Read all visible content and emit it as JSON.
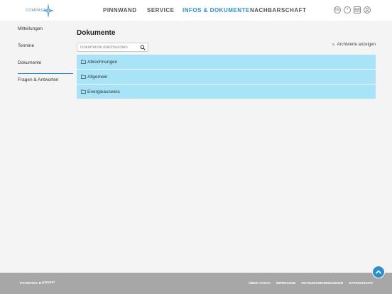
{
  "header": {
    "logo_text": "COMPASS",
    "nav": [
      {
        "label": "PINNWAND",
        "active": false
      },
      {
        "label": "SERVICE",
        "active": false
      },
      {
        "label": "INFOS & DOKUMENTE",
        "active": true
      },
      {
        "label": "NACHBARSCHAFT",
        "active": false
      }
    ],
    "icons": [
      "language-icon",
      "help-icon",
      "mail-icon",
      "user-icon"
    ],
    "language_label": "DE"
  },
  "sidebar": {
    "items": [
      {
        "label": "Mitteilungen",
        "active": false
      },
      {
        "label": "Termine",
        "active": false
      },
      {
        "label": "Dokumente",
        "active": true
      },
      {
        "label": "Fragen & Antworten",
        "active": false
      }
    ]
  },
  "main": {
    "title": "Dokumente",
    "search_placeholder": "Dokumente durchsuchen",
    "archived_label": "Archivierte anzeigen",
    "folders": [
      {
        "label": "Abrechnungen"
      },
      {
        "label": "Allgemein"
      },
      {
        "label": "Energieausweis"
      }
    ]
  },
  "footer": {
    "powered_by": "POWERED BY",
    "brand": "casavi",
    "links": [
      "ÜBER CASAVI",
      "IMPRESSUM",
      "NUTZUNGSBEDINGUNGEN",
      "DATENSCHUTZ"
    ]
  },
  "colors": {
    "accent": "#2a8fd0",
    "folder_row": "#a8e3f8",
    "footer": "#a7a7a7"
  }
}
